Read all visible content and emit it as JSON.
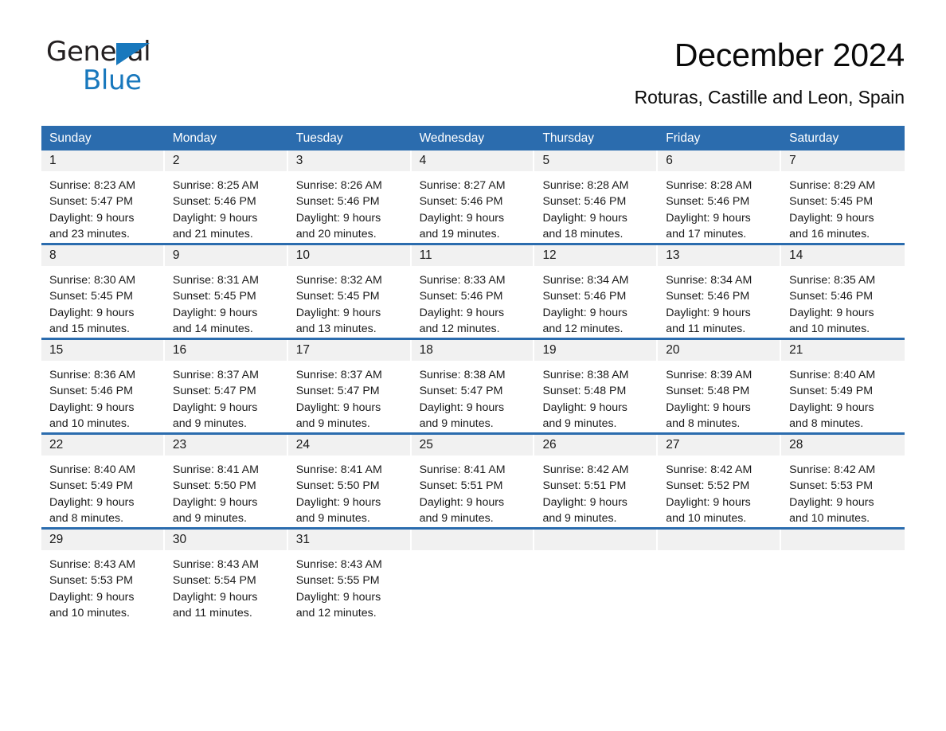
{
  "brand": {
    "name_top": "General",
    "name_bottom": "Blue",
    "triangle_color": "#1878bd",
    "top_text_color": "#231f20"
  },
  "header": {
    "month_title": "December 2024",
    "location": "Roturas, Castille and Leon, Spain"
  },
  "theme": {
    "header_blue": "#2b6cae",
    "daynum_band": "#f1f1f1",
    "text": "#1a1a1a"
  },
  "calendar": {
    "weekday_headers": [
      "Sunday",
      "Monday",
      "Tuesday",
      "Wednesday",
      "Thursday",
      "Friday",
      "Saturday"
    ],
    "weeks": [
      [
        {
          "day": "1",
          "sunrise": "Sunrise: 8:23 AM",
          "sunset": "Sunset: 5:47 PM",
          "daylight_1": "Daylight: 9 hours",
          "daylight_2": "and 23 minutes."
        },
        {
          "day": "2",
          "sunrise": "Sunrise: 8:25 AM",
          "sunset": "Sunset: 5:46 PM",
          "daylight_1": "Daylight: 9 hours",
          "daylight_2": "and 21 minutes."
        },
        {
          "day": "3",
          "sunrise": "Sunrise: 8:26 AM",
          "sunset": "Sunset: 5:46 PM",
          "daylight_1": "Daylight: 9 hours",
          "daylight_2": "and 20 minutes."
        },
        {
          "day": "4",
          "sunrise": "Sunrise: 8:27 AM",
          "sunset": "Sunset: 5:46 PM",
          "daylight_1": "Daylight: 9 hours",
          "daylight_2": "and 19 minutes."
        },
        {
          "day": "5",
          "sunrise": "Sunrise: 8:28 AM",
          "sunset": "Sunset: 5:46 PM",
          "daylight_1": "Daylight: 9 hours",
          "daylight_2": "and 18 minutes."
        },
        {
          "day": "6",
          "sunrise": "Sunrise: 8:28 AM",
          "sunset": "Sunset: 5:46 PM",
          "daylight_1": "Daylight: 9 hours",
          "daylight_2": "and 17 minutes."
        },
        {
          "day": "7",
          "sunrise": "Sunrise: 8:29 AM",
          "sunset": "Sunset: 5:45 PM",
          "daylight_1": "Daylight: 9 hours",
          "daylight_2": "and 16 minutes."
        }
      ],
      [
        {
          "day": "8",
          "sunrise": "Sunrise: 8:30 AM",
          "sunset": "Sunset: 5:45 PM",
          "daylight_1": "Daylight: 9 hours",
          "daylight_2": "and 15 minutes."
        },
        {
          "day": "9",
          "sunrise": "Sunrise: 8:31 AM",
          "sunset": "Sunset: 5:45 PM",
          "daylight_1": "Daylight: 9 hours",
          "daylight_2": "and 14 minutes."
        },
        {
          "day": "10",
          "sunrise": "Sunrise: 8:32 AM",
          "sunset": "Sunset: 5:45 PM",
          "daylight_1": "Daylight: 9 hours",
          "daylight_2": "and 13 minutes."
        },
        {
          "day": "11",
          "sunrise": "Sunrise: 8:33 AM",
          "sunset": "Sunset: 5:46 PM",
          "daylight_1": "Daylight: 9 hours",
          "daylight_2": "and 12 minutes."
        },
        {
          "day": "12",
          "sunrise": "Sunrise: 8:34 AM",
          "sunset": "Sunset: 5:46 PM",
          "daylight_1": "Daylight: 9 hours",
          "daylight_2": "and 12 minutes."
        },
        {
          "day": "13",
          "sunrise": "Sunrise: 8:34 AM",
          "sunset": "Sunset: 5:46 PM",
          "daylight_1": "Daylight: 9 hours",
          "daylight_2": "and 11 minutes."
        },
        {
          "day": "14",
          "sunrise": "Sunrise: 8:35 AM",
          "sunset": "Sunset: 5:46 PM",
          "daylight_1": "Daylight: 9 hours",
          "daylight_2": "and 10 minutes."
        }
      ],
      [
        {
          "day": "15",
          "sunrise": "Sunrise: 8:36 AM",
          "sunset": "Sunset: 5:46 PM",
          "daylight_1": "Daylight: 9 hours",
          "daylight_2": "and 10 minutes."
        },
        {
          "day": "16",
          "sunrise": "Sunrise: 8:37 AM",
          "sunset": "Sunset: 5:47 PM",
          "daylight_1": "Daylight: 9 hours",
          "daylight_2": "and 9 minutes."
        },
        {
          "day": "17",
          "sunrise": "Sunrise: 8:37 AM",
          "sunset": "Sunset: 5:47 PM",
          "daylight_1": "Daylight: 9 hours",
          "daylight_2": "and 9 minutes."
        },
        {
          "day": "18",
          "sunrise": "Sunrise: 8:38 AM",
          "sunset": "Sunset: 5:47 PM",
          "daylight_1": "Daylight: 9 hours",
          "daylight_2": "and 9 minutes."
        },
        {
          "day": "19",
          "sunrise": "Sunrise: 8:38 AM",
          "sunset": "Sunset: 5:48 PM",
          "daylight_1": "Daylight: 9 hours",
          "daylight_2": "and 9 minutes."
        },
        {
          "day": "20",
          "sunrise": "Sunrise: 8:39 AM",
          "sunset": "Sunset: 5:48 PM",
          "daylight_1": "Daylight: 9 hours",
          "daylight_2": "and 8 minutes."
        },
        {
          "day": "21",
          "sunrise": "Sunrise: 8:40 AM",
          "sunset": "Sunset: 5:49 PM",
          "daylight_1": "Daylight: 9 hours",
          "daylight_2": "and 8 minutes."
        }
      ],
      [
        {
          "day": "22",
          "sunrise": "Sunrise: 8:40 AM",
          "sunset": "Sunset: 5:49 PM",
          "daylight_1": "Daylight: 9 hours",
          "daylight_2": "and 8 minutes."
        },
        {
          "day": "23",
          "sunrise": "Sunrise: 8:41 AM",
          "sunset": "Sunset: 5:50 PM",
          "daylight_1": "Daylight: 9 hours",
          "daylight_2": "and 9 minutes."
        },
        {
          "day": "24",
          "sunrise": "Sunrise: 8:41 AM",
          "sunset": "Sunset: 5:50 PM",
          "daylight_1": "Daylight: 9 hours",
          "daylight_2": "and 9 minutes."
        },
        {
          "day": "25",
          "sunrise": "Sunrise: 8:41 AM",
          "sunset": "Sunset: 5:51 PM",
          "daylight_1": "Daylight: 9 hours",
          "daylight_2": "and 9 minutes."
        },
        {
          "day": "26",
          "sunrise": "Sunrise: 8:42 AM",
          "sunset": "Sunset: 5:51 PM",
          "daylight_1": "Daylight: 9 hours",
          "daylight_2": "and 9 minutes."
        },
        {
          "day": "27",
          "sunrise": "Sunrise: 8:42 AM",
          "sunset": "Sunset: 5:52 PM",
          "daylight_1": "Daylight: 9 hours",
          "daylight_2": "and 10 minutes."
        },
        {
          "day": "28",
          "sunrise": "Sunrise: 8:42 AM",
          "sunset": "Sunset: 5:53 PM",
          "daylight_1": "Daylight: 9 hours",
          "daylight_2": "and 10 minutes."
        }
      ],
      [
        {
          "day": "29",
          "sunrise": "Sunrise: 8:43 AM",
          "sunset": "Sunset: 5:53 PM",
          "daylight_1": "Daylight: 9 hours",
          "daylight_2": "and 10 minutes."
        },
        {
          "day": "30",
          "sunrise": "Sunrise: 8:43 AM",
          "sunset": "Sunset: 5:54 PM",
          "daylight_1": "Daylight: 9 hours",
          "daylight_2": "and 11 minutes."
        },
        {
          "day": "31",
          "sunrise": "Sunrise: 8:43 AM",
          "sunset": "Sunset: 5:55 PM",
          "daylight_1": "Daylight: 9 hours",
          "daylight_2": "and 12 minutes."
        },
        {
          "day": "",
          "sunrise": "",
          "sunset": "",
          "daylight_1": "",
          "daylight_2": ""
        },
        {
          "day": "",
          "sunrise": "",
          "sunset": "",
          "daylight_1": "",
          "daylight_2": ""
        },
        {
          "day": "",
          "sunrise": "",
          "sunset": "",
          "daylight_1": "",
          "daylight_2": ""
        },
        {
          "day": "",
          "sunrise": "",
          "sunset": "",
          "daylight_1": "",
          "daylight_2": ""
        }
      ]
    ]
  }
}
